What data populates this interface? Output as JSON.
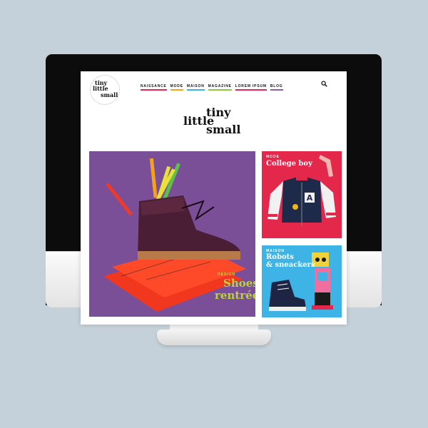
{
  "site": {
    "logo_badge_lines": [
      "tiny",
      "little",
      "small"
    ],
    "wordmark": {
      "line1": "tiny",
      "line2": "little",
      "line3": "small"
    },
    "nav": [
      {
        "label": "NAISSANCE",
        "color": "#e5265b"
      },
      {
        "label": "MODE",
        "color": "#f0a51a"
      },
      {
        "label": "MAISON",
        "color": "#3db3e6"
      },
      {
        "label": "MAGAZINE",
        "color": "#8ec63f"
      },
      {
        "label": "LOREM IPSUM",
        "color": "#e5265b"
      },
      {
        "label": "BLOG",
        "color": "#8c5ea8"
      }
    ],
    "search_icon": "search-icon"
  },
  "tiles": {
    "main": {
      "kicker": "DESIGN",
      "title_line1": "Shoes",
      "title_line2": "rentrée",
      "kicker_color": "#b9d43a",
      "title_color": "#b9d43a"
    },
    "top": {
      "kicker": "MODE",
      "title": "College boy",
      "kicker_color": "#ffffff",
      "title_color": "#ffffff"
    },
    "bottom": {
      "kicker": "MAISON",
      "title_line1": "Robots",
      "title_line2": "& sneackers",
      "kicker_color": "#ffffff",
      "title_color": "#ffffff"
    }
  },
  "colors": {
    "background": "#c5d1da",
    "purple": "#7b4f98",
    "red": "#e3284c",
    "blue": "#3db3e6"
  }
}
